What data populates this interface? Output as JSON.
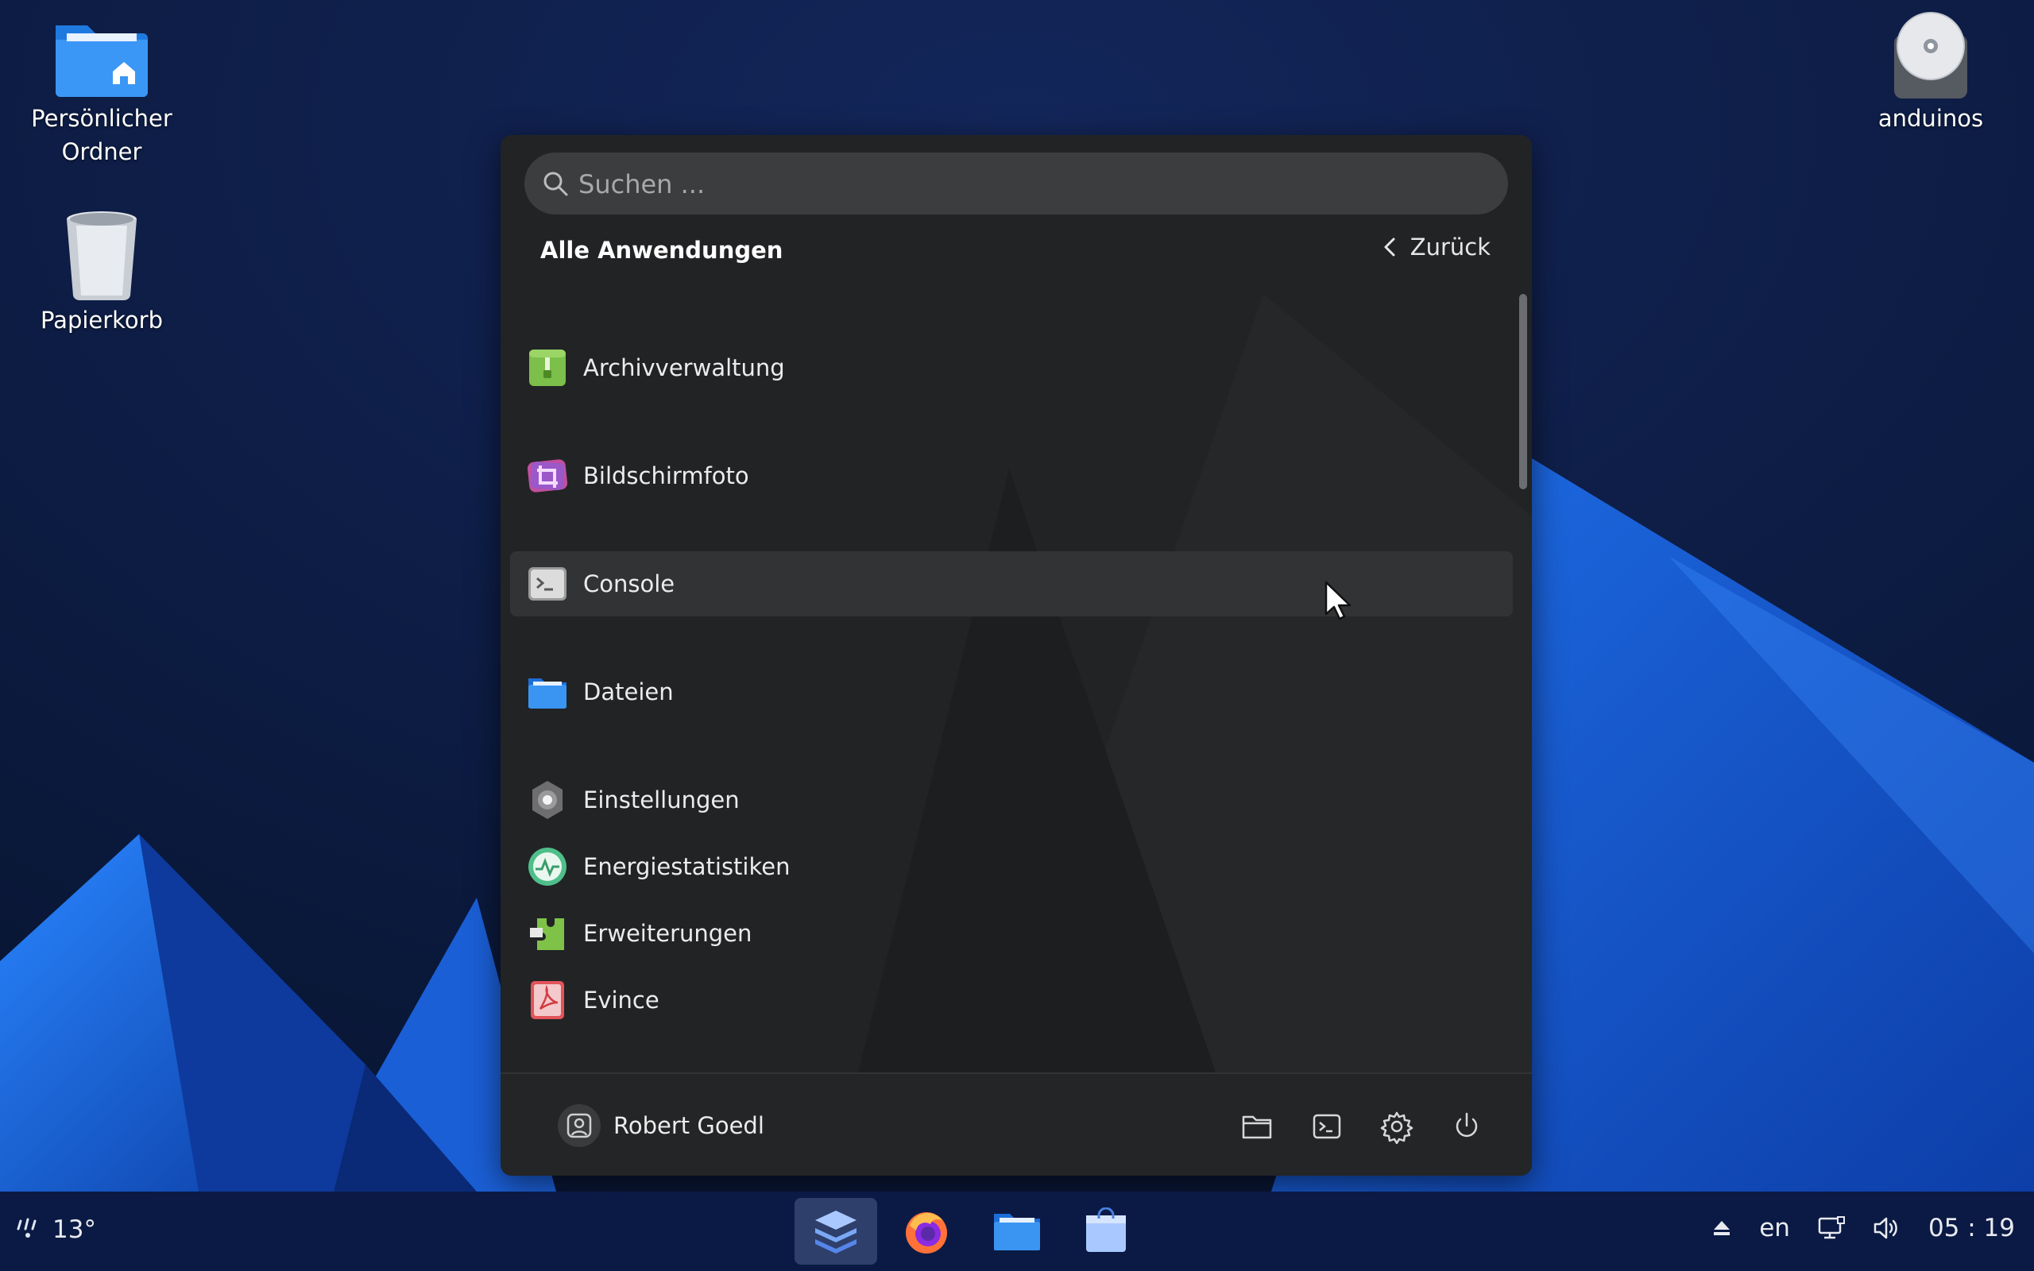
{
  "desktop": {
    "icons": [
      {
        "label": "Persönlicher Ordner",
        "icon": "home-folder-icon"
      },
      {
        "label": "Papierkorb",
        "icon": "trash-icon"
      },
      {
        "label": "anduinos",
        "icon": "disc-drive-icon"
      }
    ]
  },
  "launcher": {
    "search_placeholder": "Suchen ...",
    "section_title": "Alle Anwendungen",
    "back_label": "Zurück",
    "apps": [
      {
        "name": "Archivverwaltung",
        "icon": "archive-manager-icon"
      },
      {
        "name": "Bildschirmfoto",
        "icon": "screenshot-icon"
      },
      {
        "name": "Console",
        "icon": "console-icon",
        "hovered": true
      },
      {
        "name": "Dateien",
        "icon": "files-icon"
      },
      {
        "name": "Einstellungen",
        "icon": "settings-icon"
      },
      {
        "name": "Energiestatistiken",
        "icon": "power-statistics-icon"
      },
      {
        "name": "Erweiterungen",
        "icon": "extensions-icon"
      },
      {
        "name": "Evince",
        "icon": "document-viewer-icon"
      }
    ],
    "footer": {
      "user_name": "Robert Goedl",
      "buttons": [
        "folder-icon",
        "terminal-icon",
        "gear-icon",
        "power-icon"
      ]
    }
  },
  "taskbar": {
    "weather_temp": "13°",
    "dock": [
      "app-grid-icon",
      "firefox-icon",
      "files-icon",
      "software-store-icon"
    ],
    "keyboard_layout": "en",
    "clock": "05 : 19"
  },
  "colors": {
    "accent": "#2f7bf0",
    "launcher_bg": "#222325",
    "taskbar_bg": "#0b1a44"
  }
}
